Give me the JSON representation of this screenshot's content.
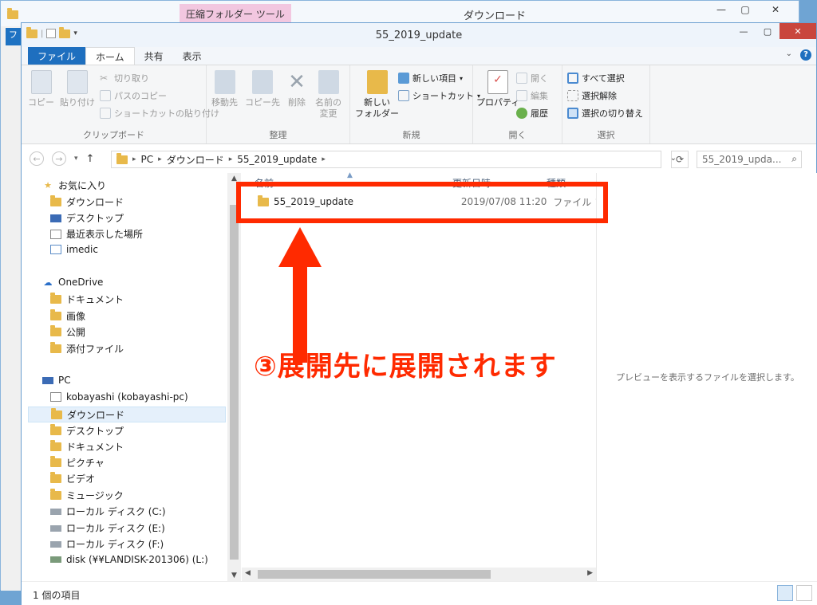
{
  "background_window": {
    "title": "ダウンロード",
    "context_tab": "圧縮フォルダー ツール",
    "file_tab_initial": "フ"
  },
  "window": {
    "title": "55_2019_update"
  },
  "ribbon_tabs": {
    "file": "ファイル",
    "home": "ホーム",
    "share": "共有",
    "view": "表示"
  },
  "ribbon": {
    "clipboard": {
      "copy": "コピー",
      "paste": "貼り付け",
      "cut": "切り取り",
      "copy_path": "パスのコピー",
      "paste_shortcut": "ショートカットの貼り付け",
      "label": "クリップボード"
    },
    "organize": {
      "move_to": "移動先",
      "copy_to": "コピー先",
      "delete": "削除",
      "rename_line1": "名前の",
      "rename_line2": "変更",
      "label": "整理"
    },
    "new": {
      "new_folder_line1": "新しい",
      "new_folder_line2": "フォルダー",
      "new_item": "新しい項目",
      "shortcut": "ショートカット",
      "label": "新規"
    },
    "open": {
      "properties": "プロパティ",
      "open": "開く",
      "edit": "編集",
      "history": "履歴",
      "label": "開く"
    },
    "select": {
      "select_all": "すべて選択",
      "select_none": "選択解除",
      "invert": "選択の切り替え",
      "label": "選択"
    }
  },
  "address": {
    "segments": [
      "PC",
      "ダウンロード",
      "55_2019_update"
    ],
    "search_placeholder": "55_2019_upda..."
  },
  "nav_pane": {
    "favorites": "お気に入り",
    "fav_items": [
      "ダウンロード",
      "デスクトップ",
      "最近表示した場所",
      "imedic"
    ],
    "onedrive": "OneDrive",
    "onedrive_items": [
      "ドキュメント",
      "画像",
      "公開",
      "添付ファイル"
    ],
    "pc": "PC",
    "pc_items": [
      "kobayashi (kobayashi-pc)",
      "ダウンロード",
      "デスクトップ",
      "ドキュメント",
      "ピクチャ",
      "ビデオ",
      "ミュージック",
      "ローカル ディスク (C:)",
      "ローカル ディスク (E:)",
      "ローカル ディスク (F:)",
      "disk (¥¥LANDISK-201306) (L:)"
    ]
  },
  "columns": {
    "name": "名前",
    "date": "更新日時",
    "type": "種類"
  },
  "files": [
    {
      "name": "55_2019_update",
      "date": "2019/07/08 11:20",
      "type": "ファイル フォルダー"
    }
  ],
  "preview_text": "プレビューを表示するファイルを選択します。",
  "status": "1 個の項目",
  "annotation": "③展開先に展開されます",
  "colors": {
    "accent": "#1e6fbf",
    "annotation": "#ff2a00",
    "folder": "#e8b94a"
  }
}
